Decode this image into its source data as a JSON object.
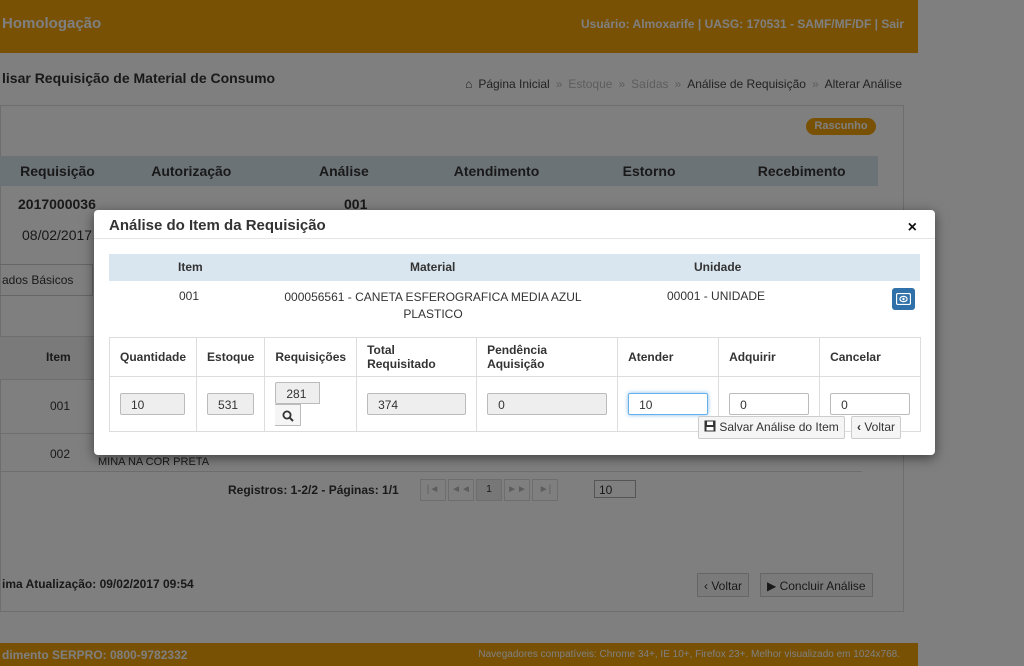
{
  "header": {
    "env": "Homologação",
    "user_info": "Usuário: Almoxarife | UASG: 170531 - SAMF/MF/DF | Sair"
  },
  "page": {
    "title": "lisar Requisição de Material de Consumo"
  },
  "breadcrumb": {
    "home": "Página Inicial",
    "estoque": "Estoque",
    "saidas": "Saídas",
    "analise": "Análise de Requisição",
    "alterar": "Alterar Análise"
  },
  "status_badge": "Rascunho",
  "steps": [
    "Requisição",
    "Autorização",
    "Análise",
    "Atendimento",
    "Estorno",
    "Recebimento"
  ],
  "requisicao": {
    "numero": "2017000036",
    "data": "08/02/2017",
    "analise": "001"
  },
  "tab": "ados Básicos",
  "grid": {
    "item_header": "Item",
    "rows": [
      {
        "item": "001"
      },
      {
        "item": "002",
        "desc": "MINA NA COR PRETA"
      }
    ],
    "records": "Registros: 1-2/2 - Páginas: 1/1",
    "page": "1",
    "page_size": "10"
  },
  "last_update": "ima Atualização: 09/02/2017 09:54",
  "bg_buttons": {
    "voltar": "Voltar",
    "concluir": "Concluir Análise"
  },
  "footer": {
    "left": "dimento SERPRO: 0800-9782332",
    "right": "Navegadores compatíveis: Chrome 34+, IE 10+, Firefox 23+. Melhor visualizado em 1024x768."
  },
  "modal": {
    "title": "Análise do Item da Requisição",
    "close": "×",
    "item_headers": {
      "item": "Item",
      "material": "Material",
      "unidade": "Unidade"
    },
    "item": {
      "item": "001",
      "material": "000056561 - CANETA ESFEROGRAFICA MEDIA AZUL PLASTICO",
      "unidade": "00001 - UNIDADE"
    },
    "columns": [
      "Quantidade",
      "Estoque",
      "Requisições",
      "Total Requisitado",
      "Pendência Aquisição",
      "Atender",
      "Adquirir",
      "Cancelar"
    ],
    "values": {
      "quantidade": "10",
      "estoque": "531",
      "requisicoes": "281",
      "total_requisitado": "374",
      "pendencia": "0",
      "atender": "10",
      "adquirir": "0",
      "cancelar": "0"
    },
    "save_label": "Salvar Análise do Item",
    "back_label": "Voltar"
  }
}
